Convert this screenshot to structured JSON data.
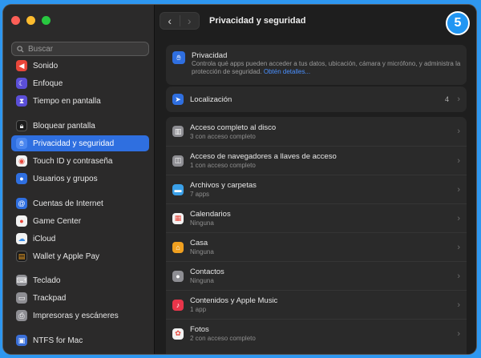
{
  "badge": "5",
  "search": {
    "placeholder": "Buscar"
  },
  "sidebar": {
    "items": [
      {
        "label": "Sonido",
        "icon": "speaker-icon",
        "color": "#e8463a"
      },
      {
        "label": "Enfoque",
        "icon": "moon-icon",
        "color": "#5b4fd8"
      },
      {
        "label": "Tiempo en pantalla",
        "icon": "hourglass-icon",
        "color": "#5b4fd8"
      },
      {
        "label": "Bloquear pantalla",
        "icon": "lock-icon",
        "color": "#1c1c1c"
      },
      {
        "label": "Privacidad y seguridad",
        "icon": "hand-icon",
        "color": "#2f6fe0"
      },
      {
        "label": "Touch ID y contraseña",
        "icon": "fingerprint-icon",
        "color": "#f2f2f2"
      },
      {
        "label": "Usuarios y grupos",
        "icon": "users-icon",
        "color": "#2f6fe0"
      },
      {
        "label": "Cuentas de Internet",
        "icon": "at-icon",
        "color": "#2f6fe0"
      },
      {
        "label": "Game Center",
        "icon": "game-center-icon",
        "color": "#f2f2f2"
      },
      {
        "label": "iCloud",
        "icon": "cloud-icon",
        "color": "#f2f2f2"
      },
      {
        "label": "Wallet y Apple Pay",
        "icon": "wallet-icon",
        "color": "#1c1c1c"
      },
      {
        "label": "Teclado",
        "icon": "keyboard-icon",
        "color": "#8e8e93"
      },
      {
        "label": "Trackpad",
        "icon": "trackpad-icon",
        "color": "#8e8e93"
      },
      {
        "label": "Impresoras y escáneres",
        "icon": "printer-icon",
        "color": "#8e8e93"
      },
      {
        "label": "NTFS for Mac",
        "icon": "ntfs-icon",
        "color": "#3a6fd8"
      }
    ]
  },
  "main": {
    "title": "Privacidad y seguridad",
    "privacy": {
      "title": "Privacidad",
      "description": "Controla qué apps pueden acceder a tus datos, ubicación, cámara y micrófono, y administra la protección de seguridad.",
      "link": "Obtén detalles..."
    },
    "location": {
      "title": "Localización",
      "count": "4"
    },
    "rows": [
      {
        "title": "Acceso completo al disco",
        "sub": "3 con acceso completo",
        "icon": "disk-icon",
        "color": "#8e8e93"
      },
      {
        "title": "Acceso de navegadores a llaves de acceso",
        "sub": "1 con acceso completo",
        "icon": "browser-icon",
        "color": "#8e8e93"
      },
      {
        "title": "Archivos y carpetas",
        "sub": "7 apps",
        "icon": "folder-icon",
        "color": "#3aa0e8"
      },
      {
        "title": "Calendarios",
        "sub": "Ninguna",
        "icon": "calendar-icon",
        "color": "#e8463a"
      },
      {
        "title": "Casa",
        "sub": "Ninguna",
        "icon": "home-icon",
        "color": "#f0a020"
      },
      {
        "title": "Contactos",
        "sub": "Ninguna",
        "icon": "contacts-icon",
        "color": "#8e8e93"
      },
      {
        "title": "Contenidos y Apple Music",
        "sub": "1 app",
        "icon": "music-icon",
        "color": "#e8354a"
      },
      {
        "title": "Fotos",
        "sub": "2 con acceso completo",
        "icon": "photos-icon",
        "color": "#f2f2f2"
      }
    ]
  }
}
